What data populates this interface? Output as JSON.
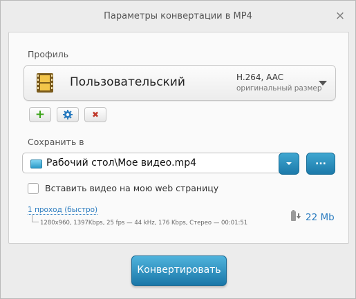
{
  "window": {
    "title": "Параметры конвертации в MP4",
    "close_glyph": "×"
  },
  "profile": {
    "label": "Профиль",
    "name": "Пользовательский",
    "codec": "H.264, AAC",
    "size": "оригинальный размер",
    "icon": "film-strip-icon"
  },
  "profile_actions": {
    "add_glyph": "+",
    "settings_icon": "gear-icon",
    "remove_glyph": "✖"
  },
  "save": {
    "label": "Сохранить в",
    "path": "Рабочий стол\\Мое видео.mp4",
    "browse_label": "..."
  },
  "embed": {
    "label": "Вставить видео на мою web страницу",
    "checked": false
  },
  "encoding": {
    "pass_link": "1 проход (быстро)",
    "details": "1280x960, 1397Kbps, 25 fps — 44 kHz, 176 Kbps, Стерео — 00:01:51",
    "size": "22 Mb"
  },
  "convert_label": "Конвертировать",
  "colors": {
    "accent": "#1c7aaa",
    "link": "#2a7bbf",
    "add": "#3aa317",
    "remove": "#c0392b",
    "gear": "#2a7bbf"
  }
}
